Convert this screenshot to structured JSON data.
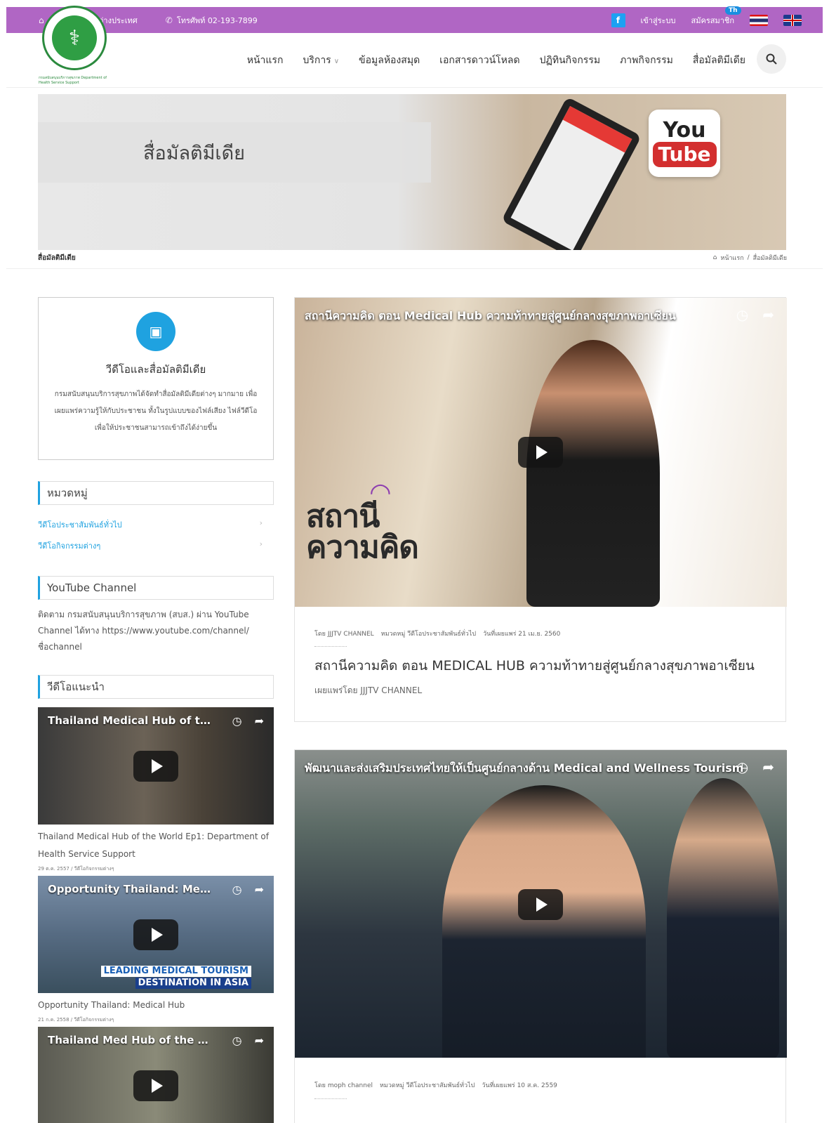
{
  "topbar": {
    "org": "กองสุขภาพระหว่างประเทศ",
    "phone": "โทรศัพท์ 02-193-7899",
    "facebook": "f",
    "login": "เข้าสู่ระบบ",
    "register": "สมัครสมาชิก",
    "lang_badge": "Th"
  },
  "header": {
    "logo_sub": "กรมสนับสนุนบริการสุขภาพ Department of Health Service Support",
    "nav": [
      "หน้าแรก",
      "บริการ",
      "ข้อมูลห้องสมุด",
      "เอกสารดาวน์โหลด",
      "ปฏิทินกิจกรรม",
      "ภาพกิจกรรม",
      "สื่อมัลติมีเดีย"
    ]
  },
  "banner": {
    "title": "สื่อมัลติมีเดีย",
    "yt_you": "You",
    "yt_tube": "Tube"
  },
  "breadcrumb": {
    "page": "สื่อมัลติมีเดีย",
    "home": "หน้าแรก",
    "sep": "/",
    "current": "สื่อมัลติมีเดีย"
  },
  "sidebar": {
    "about_title": "วีดีโอและสื่อมัลติมีเดีย",
    "about_text": "กรมสนับสนุนบริการสุขภาพได้จัดทำสื่อมัลติมีเดียต่างๆ มากมาย เพื่อเผยแพร่ความรู้ให้กับประชาชน ทั้งในรูปแบบของไฟล์เสียง ไฟล์วีดีโอ เพื่อให้ประชาชนสามารถเข้าถึงได้ง่ายขึ้น",
    "categories_title": "หมวดหมู่",
    "categories": [
      "วีดีโอประชาสัมพันธ์ทั่วไป",
      "วีดีโอกิจกรรมต่างๆ"
    ],
    "youtube_title": "YouTube Channel",
    "youtube_text": "ติดตาม กรมสนับสนุนบริการสุขภาพ (สบส.) ผ่าน YouTube Channel ได้ทาง https://www.youtube.com/channel/ชื่อchannel",
    "recommended_title": "วีดีโอแนะนำ",
    "videos": [
      {
        "thumb_title": "Thailand Medical Hub of the W...",
        "caption": "Thailand Medical Hub of the World Ep1: Department of Health Service Support",
        "meta": "29 ต.ค. 2557 / วีดีโอกิจกรรมต่างๆ"
      },
      {
        "thumb_title": "Opportunity Thailand: Medical ...",
        "caption": "Opportunity Thailand: Medical Hub",
        "meta": "21 ก.ค. 2558 / วีดีโอกิจกรรมต่างๆ",
        "overlay1": "LEADING MEDICAL TOURISM",
        "overlay2": "DESTINATION IN ASIA"
      },
      {
        "thumb_title": "Thailand Med Hub of the World..."
      }
    ]
  },
  "posts": [
    {
      "video_title": "สถานีความคิด ตอน Medical Hub ความท้าทายสู่ศูนย์กลางสุขภาพอาเซียน",
      "logo_top": "สถานี",
      "logo_bottom": "ความคิด",
      "meta_by": "โดย JJJTV CHANNEL",
      "meta_cat": "หมวดหมู่ วีดีโอประชาสัมพันธ์ทั่วไป",
      "meta_date": "วันที่เผยแพร่ 21 เม.ย. 2560",
      "title": "สถานีความคิด ตอน MEDICAL HUB ความท้าทายสู่ศูนย์กลางสุขภาพอาเซียน",
      "published_by": "เผยแพร่โดย JJJTV CHANNEL"
    },
    {
      "video_title": "พัฒนาและส่งเสริมประเทศไทยให้เป็นศูนย์กลางด้าน Medical and Wellness Tourism",
      "meta_by": "โดย moph channel",
      "meta_cat": "หมวดหมู่ วีดีโอประชาสัมพันธ์ทั่วไป",
      "meta_date": "วันที่เผยแพร่ 10 ส.ค. 2559"
    }
  ],
  "colors": {
    "topbar": "#b066c4",
    "accent": "#1fa2e0"
  }
}
